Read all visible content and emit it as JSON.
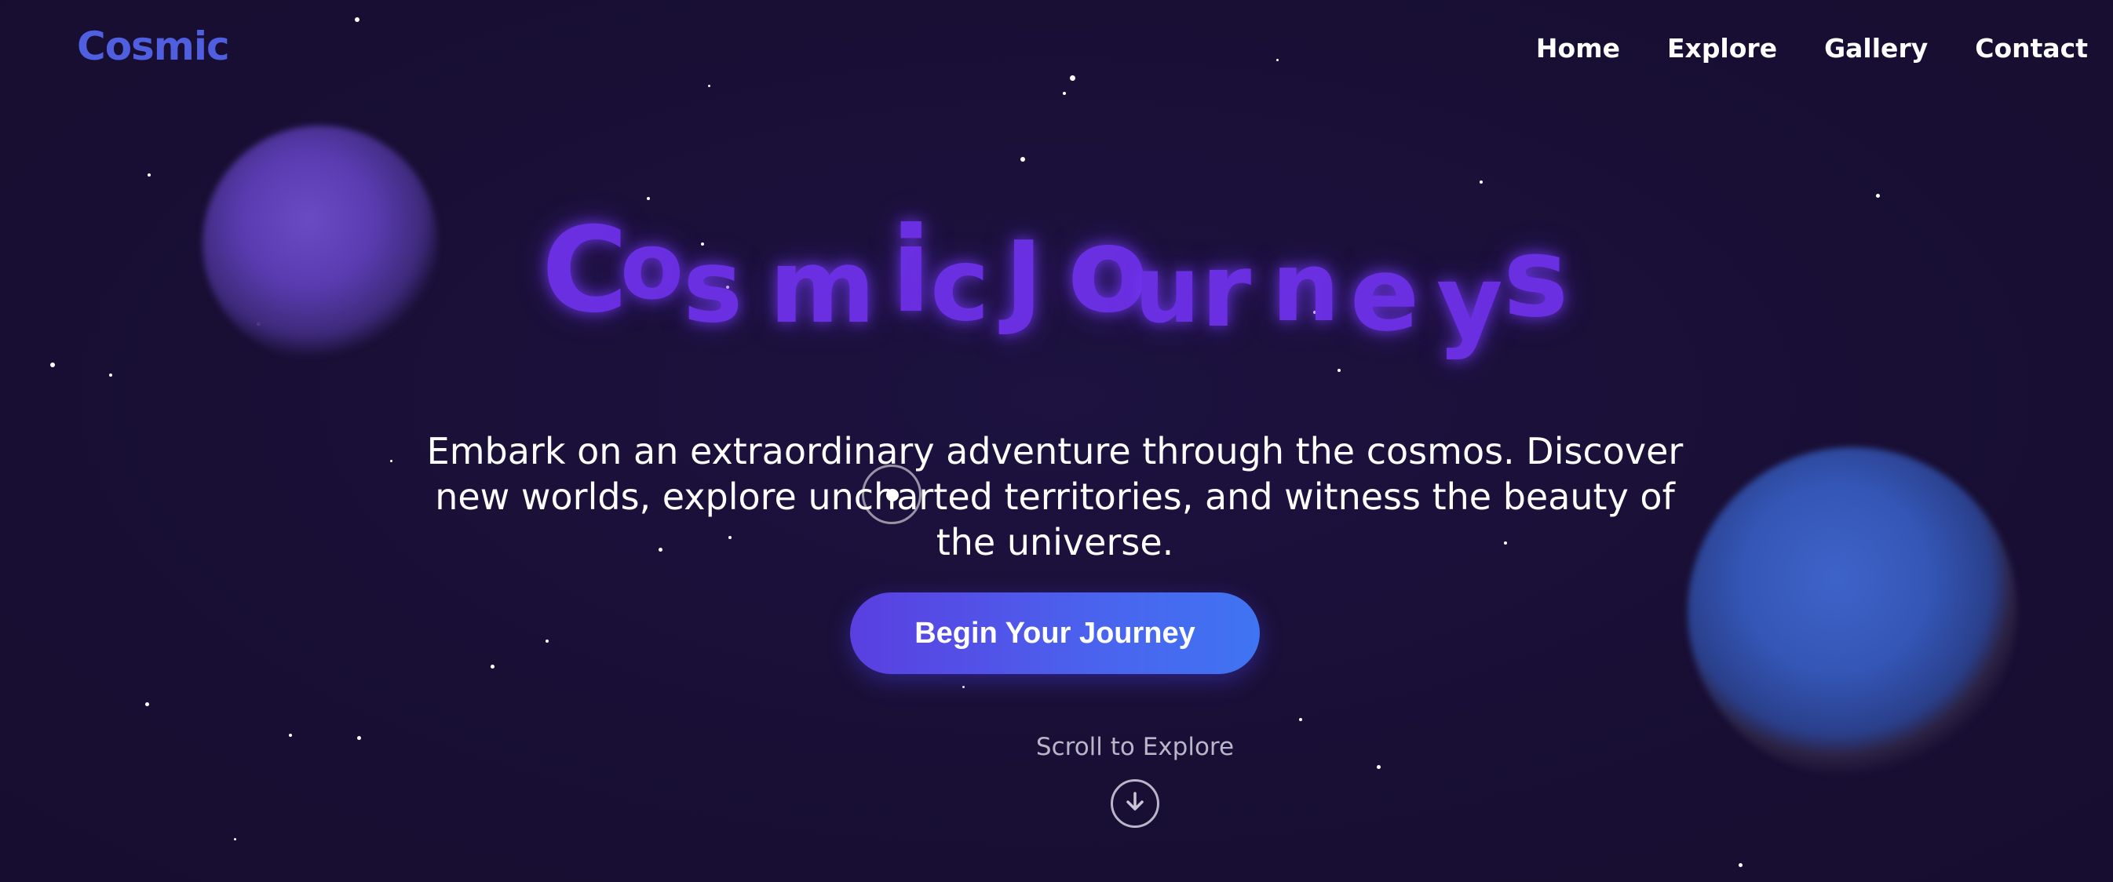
{
  "header": {
    "logo": "Cosmic",
    "nav": [
      "Home",
      "Explore",
      "Gallery",
      "Contact"
    ]
  },
  "hero": {
    "title": "CosmicJourneys",
    "subtitle": "Embark on an extraordinary adventure through the cosmos. Discover new worlds, explore uncharted territories, and witness the beauty of the universe.",
    "cta_label": "Begin Your Journey",
    "scroll_label": "Scroll to Explore"
  },
  "icons": {
    "scroll": "arrow-down-circle-icon",
    "cursor": "custom-cursor-icon"
  },
  "colors": {
    "background": "#190f35",
    "logo": "#4f5fe0",
    "title": "#6a2fe0",
    "cta_start": "#5a3fe0",
    "cta_end": "#3f74f2",
    "planet_purple": "#6a4bc4",
    "planet_blue": "#3e63c9"
  }
}
